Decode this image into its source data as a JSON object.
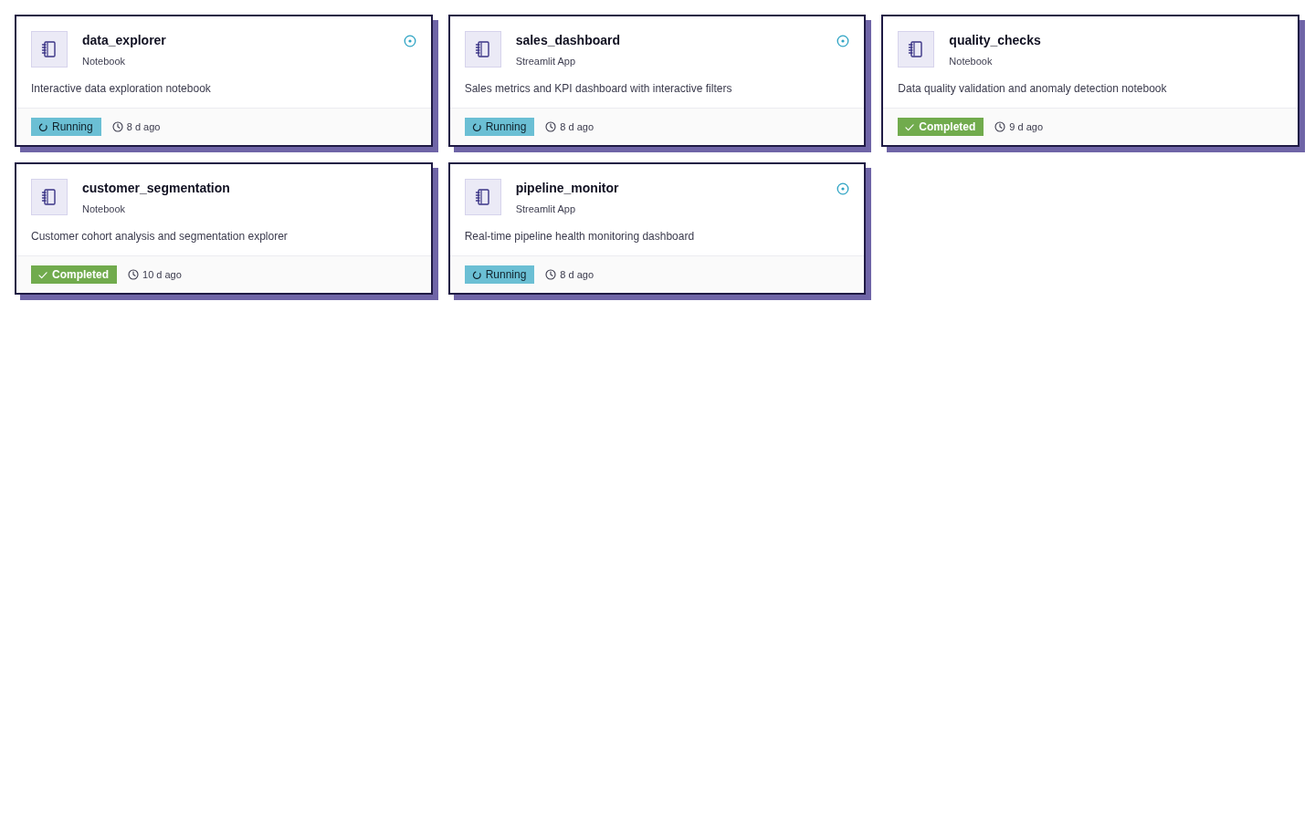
{
  "cards": [
    {
      "title": "data_explorer",
      "type": "Notebook",
      "description": "Interactive data exploration notebook",
      "status": {
        "kind": "running",
        "label": "Running"
      },
      "age": "8 d ago"
    },
    {
      "title": "sales_dashboard",
      "type": "Streamlit App",
      "description": "Sales metrics and KPI dashboard with interactive filters",
      "status": {
        "kind": "running",
        "label": "Running"
      },
      "age": "8 d ago"
    },
    {
      "title": "quality_checks",
      "type": "Notebook",
      "description": "Data quality validation and anomaly detection notebook",
      "status": {
        "kind": "completed",
        "label": "Completed"
      },
      "age": "9 d ago"
    },
    {
      "title": "customer_segmentation",
      "type": "Notebook",
      "description": "Customer cohort analysis and segmentation explorer",
      "status": {
        "kind": "completed",
        "label": "Completed"
      },
      "age": "10 d ago"
    },
    {
      "title": "pipeline_monitor",
      "type": "Streamlit App",
      "description": "Real-time pipeline health monitoring dashboard",
      "status": {
        "kind": "running",
        "label": "Running"
      },
      "age": "8 d ago"
    }
  ]
}
